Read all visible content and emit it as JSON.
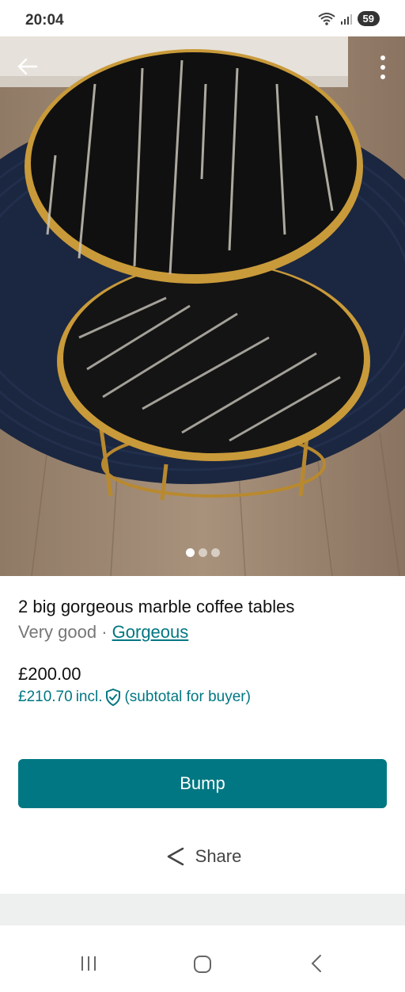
{
  "status_bar": {
    "time": "20:04",
    "battery": "59"
  },
  "photo": {
    "page_count": 3,
    "active_index": 0
  },
  "listing": {
    "title": "2 big gorgeous marble coffee tables",
    "condition": "Very good",
    "separator": " · ",
    "brand": "Gorgeous",
    "price": "£200.00",
    "buyer_price": "£210.70",
    "buyer_incl": "incl.",
    "buyer_note": "(subtotal for buyer)"
  },
  "actions": {
    "bump_label": "Bump",
    "share_label": "Share"
  },
  "colors": {
    "accent": "#007782",
    "text": "#111111",
    "muted": "#777777"
  },
  "icons": [
    "back-arrow-icon",
    "more-vert-icon",
    "shield-check-icon",
    "share-icon",
    "recent-apps-icon",
    "home-icon",
    "back-nav-icon"
  ]
}
